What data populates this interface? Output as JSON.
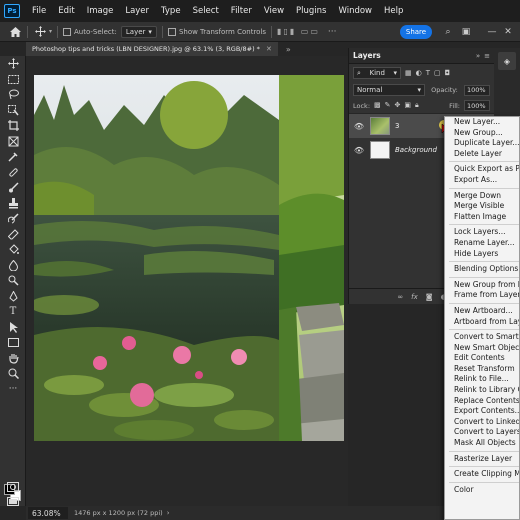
{
  "menubar": {
    "logo": "Ps",
    "items": [
      "File",
      "Edit",
      "Image",
      "Layer",
      "Type",
      "Select",
      "Filter",
      "View",
      "Plugins",
      "Window",
      "Help"
    ]
  },
  "options": {
    "auto_select_label": "Auto-Select:",
    "auto_select_value": "Layer",
    "show_transform_label": "Show Transform Controls",
    "share_label": "Share"
  },
  "document": {
    "tab_title": "Photoshop tips and tricks (LBN DESIGNER).jpg @ 63.1% (3, RGB/8#) *"
  },
  "status": {
    "zoom": "63.08%",
    "doc_info": "1476 px x 1200 px (72 ppi)"
  },
  "layers_panel": {
    "title": "Layers",
    "kind_label": "Kind",
    "blend_mode": "Normal",
    "opacity_label": "Opacity:",
    "opacity_value": "100%",
    "lock_label": "Lock:",
    "fill_label": "Fill:",
    "fill_value": "100%",
    "layers": [
      {
        "name": "3",
        "selected": true
      },
      {
        "name": "Background",
        "selected": false
      }
    ]
  },
  "context_menu": {
    "groups": [
      [
        "New Layer...",
        "New Group...",
        "Duplicate Layer...",
        "Delete Layer"
      ],
      [
        "Quick Export as PNG",
        "Export As..."
      ],
      [
        "Merge Down",
        "Merge Visible",
        "Flatten Image"
      ],
      [
        "Lock Layers...",
        "Rename Layer...",
        "Hide Layers"
      ],
      [
        "Blending Options..."
      ],
      [
        "New Group from Layers...",
        "Frame from Layers..."
      ],
      [
        "New Artboard...",
        "Artboard from Layers..."
      ],
      [
        "Convert to Smart Object",
        "New Smart Object via Copy",
        "Edit Contents",
        "Reset Transform",
        "Relink to File...",
        "Relink to Library Graphic...",
        "Replace Contents...",
        "Export Contents...",
        "Convert to Linked...",
        "Convert to Layers",
        "Mask All Objects"
      ],
      [
        "Rasterize Layer"
      ],
      [
        "Create Clipping Mask"
      ],
      [
        "Color"
      ]
    ]
  },
  "colors": {
    "accent": "#1473e6",
    "panel": "#323232",
    "menubar": "#1e1e1e"
  }
}
